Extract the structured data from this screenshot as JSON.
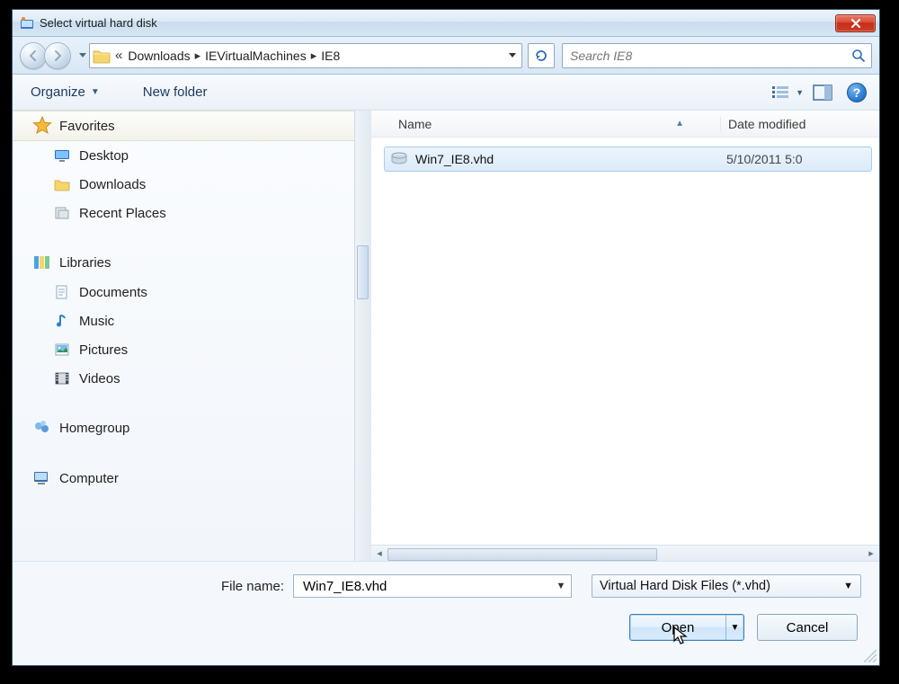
{
  "title": "Select virtual hard disk",
  "breadcrumb": {
    "prefix": "«",
    "parts": [
      "Downloads",
      "IEVirtualMachines",
      "IE8"
    ]
  },
  "search": {
    "placeholder": "Search IE8"
  },
  "toolbar": {
    "organize": "Organize",
    "newfolder": "New folder"
  },
  "sidebar": {
    "favorites": {
      "label": "Favorites",
      "items": [
        "Desktop",
        "Downloads",
        "Recent Places"
      ]
    },
    "libraries": {
      "label": "Libraries",
      "items": [
        "Documents",
        "Music",
        "Pictures",
        "Videos"
      ]
    },
    "homegroup": {
      "label": "Homegroup"
    },
    "computer": {
      "label": "Computer"
    }
  },
  "columns": {
    "name": "Name",
    "date": "Date modified"
  },
  "files": [
    {
      "name": "Win7_IE8.vhd",
      "date": "5/10/2011 5:0"
    }
  ],
  "filename": {
    "label": "File name:",
    "value": "Win7_IE8.vhd"
  },
  "filter": "Virtual Hard Disk Files (*.vhd)",
  "buttons": {
    "open": "Open",
    "cancel": "Cancel"
  },
  "help_glyph": "?"
}
